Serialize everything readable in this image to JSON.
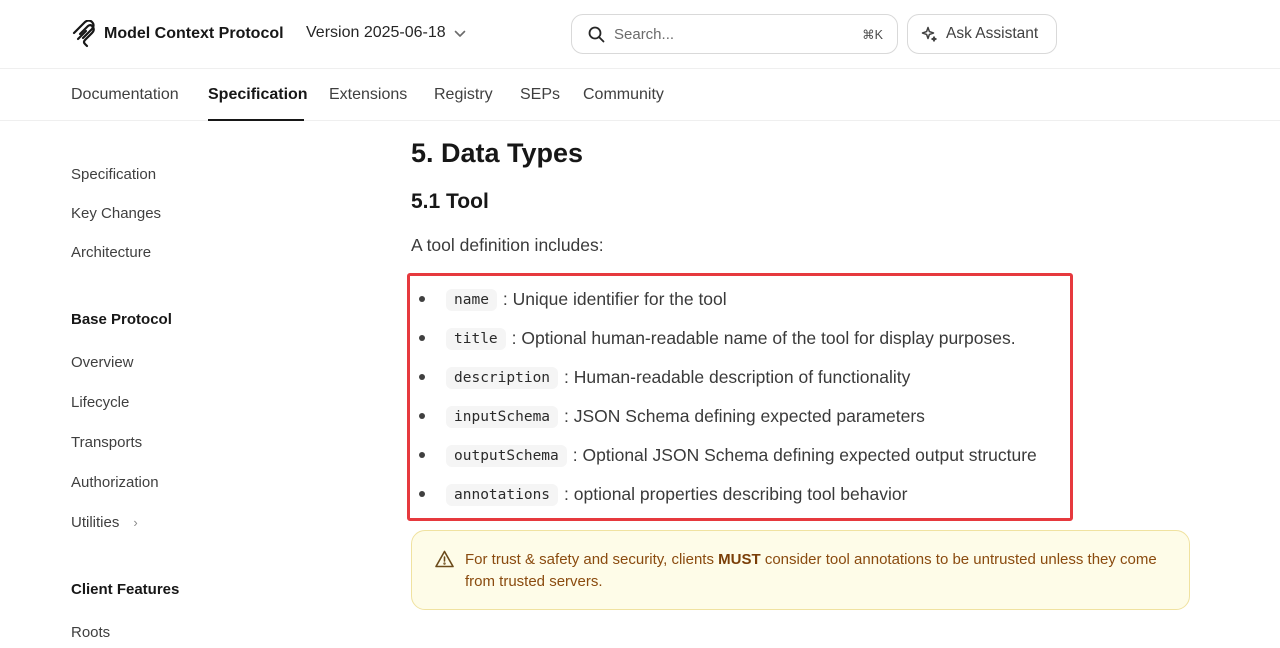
{
  "header": {
    "brand": "Model Context Protocol",
    "version": "Version 2025-06-18",
    "search_placeholder": "Search...",
    "search_shortcut": "⌘K",
    "ask_label": "Ask Assistant"
  },
  "nav": {
    "tabs": [
      {
        "label": "Documentation"
      },
      {
        "label": "Specification",
        "active": true
      },
      {
        "label": "Extensions"
      },
      {
        "label": "Registry"
      },
      {
        "label": "SEPs"
      },
      {
        "label": "Community"
      }
    ]
  },
  "sidebar": {
    "top_links": [
      "Specification",
      "Key Changes",
      "Architecture"
    ],
    "base_protocol": {
      "heading": "Base Protocol",
      "links": [
        "Overview",
        "Lifecycle",
        "Transports",
        "Authorization",
        "Utilities"
      ]
    },
    "client_features": {
      "heading": "Client Features",
      "links": [
        "Roots"
      ]
    }
  },
  "main": {
    "section_title": "5. Data Types",
    "subsection_title": "5.1 Tool",
    "intro": "A tool definition includes:",
    "items": [
      {
        "code": "name",
        "text": ": Unique identifier for the tool"
      },
      {
        "code": "title",
        "text": ": Optional human-readable name of the tool for display purposes."
      },
      {
        "code": "description",
        "text": ": Human-readable description of functionality"
      },
      {
        "code": "inputSchema",
        "text": ": JSON Schema defining expected parameters"
      },
      {
        "code": "outputSchema",
        "text": ": Optional JSON Schema defining expected output structure"
      },
      {
        "code": "annotations",
        "text": ": optional properties describing tool behavior"
      }
    ],
    "callout": {
      "before": "For trust & safety and security, clients ",
      "strong": "MUST",
      "after": " consider tool annotations to be untrusted unless they come from trusted servers."
    }
  },
  "colors": {
    "highlight_border": "#e6393e",
    "callout_bg": "#fefce8",
    "callout_text": "#8a4b0f"
  }
}
